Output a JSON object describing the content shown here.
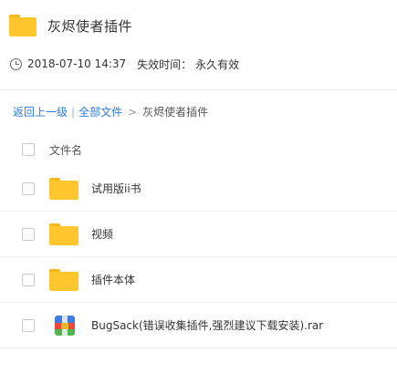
{
  "header": {
    "title": "灰烬使者插件"
  },
  "meta": {
    "date": "2018-07-10 14:37",
    "expiry_label": "失效时间：",
    "expiry_value": "永久有效"
  },
  "breadcrumb": {
    "back_label": "返回上一级",
    "separator": "|",
    "all_files_label": "全部文件",
    "arrow": ">",
    "current_label": "灰烬使者插件"
  },
  "list": {
    "column_name_label": "文件名",
    "items": [
      {
        "name": "试用版ii书",
        "icon": "folder-icon"
      },
      {
        "name": "视频",
        "icon": "folder-icon"
      },
      {
        "name": "插件本体",
        "icon": "folder-icon"
      },
      {
        "name": "BugSack(错误收集插件,强烈建议下载安装).rar",
        "icon": "rar-archive-icon"
      }
    ]
  },
  "colors": {
    "link": "#2B7BE5",
    "folder": "#FFC62E",
    "text": "#333333"
  }
}
